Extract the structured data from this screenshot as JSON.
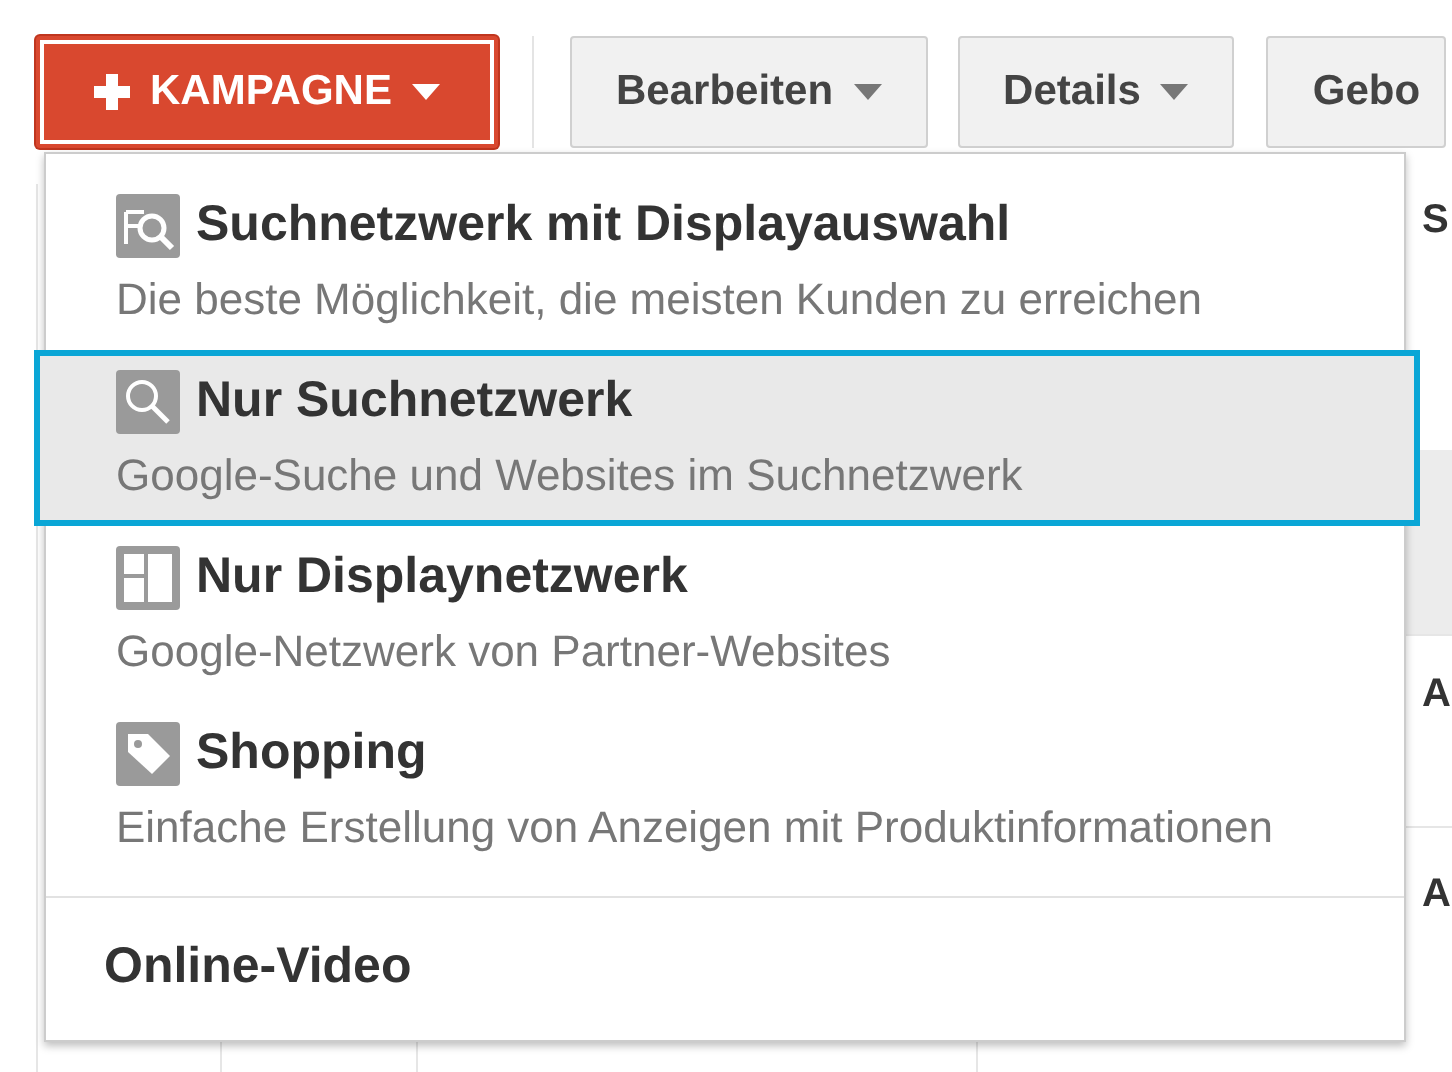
{
  "toolbar": {
    "buttons": [
      {
        "label": "KAMPAGNE",
        "kind": "primary"
      },
      {
        "label": "Bearbeiten",
        "kind": "dropdown"
      },
      {
        "label": "Details",
        "kind": "dropdown"
      },
      {
        "label": "Gebo",
        "kind": "plain"
      }
    ]
  },
  "menu": {
    "items": [
      {
        "title": "Suchnetzwerk mit Displayauswahl",
        "description": "Die beste Möglichkeit, die meisten Kunden zu erreichen",
        "kind": "search-display",
        "selected": false
      },
      {
        "title": "Nur Suchnetzwerk",
        "description": "Google-Suche und Websites im Suchnetzwerk",
        "kind": "search",
        "selected": true
      },
      {
        "title": "Nur Displaynetzwerk",
        "description": "Google-Netzwerk von Partner-Websites",
        "kind": "display",
        "selected": false
      },
      {
        "title": "Shopping",
        "description": "Einfache Erstellung von Anzeigen mit Produktinformationen",
        "kind": "shopping",
        "selected": false
      },
      {
        "title": "Online-Video",
        "kind": "plain",
        "selected": false
      }
    ]
  },
  "table": {
    "cells": [
      "S",
      "A",
      "A"
    ]
  }
}
